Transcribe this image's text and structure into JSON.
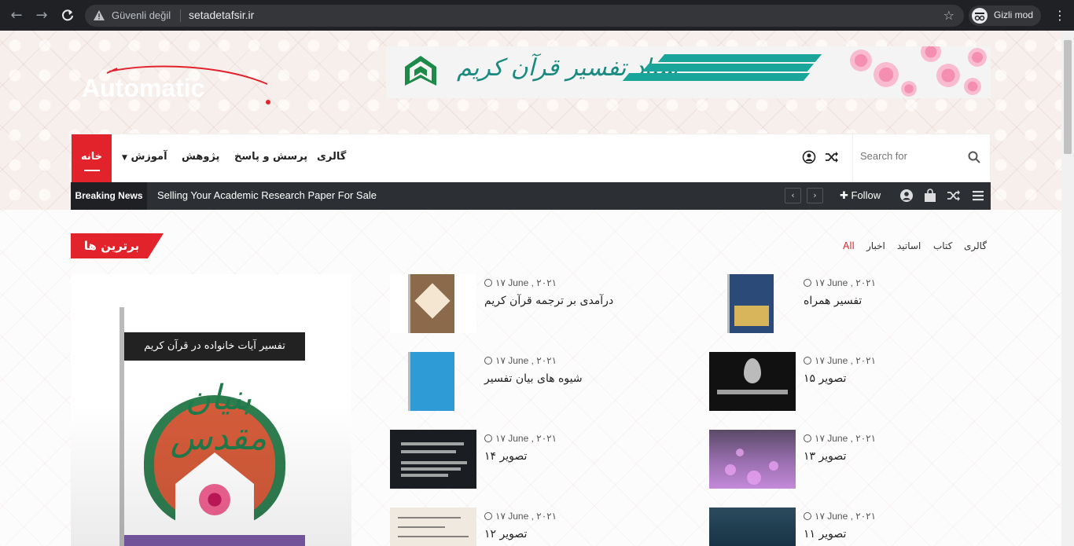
{
  "browser": {
    "back_icon": "arrow-left-icon",
    "forward_icon": "arrow-right-icon",
    "reload_icon": "reload-icon",
    "security_label": "Güvenli değil",
    "url": "setadetafsir.ir",
    "incognito_label": "Gizli mod"
  },
  "header": {
    "logo_text": "Automatic",
    "banner_title": "ستاد تفسیر قرآن کریم"
  },
  "nav": {
    "home": "خانه",
    "items": [
      "آموزش",
      "پژوهش",
      "پرسش و پاسخ",
      "گالری"
    ],
    "search_placeholder": "Search for"
  },
  "breaking": {
    "label": "Breaking News",
    "headline": "Selling Your Academic Research Paper For Sale",
    "follow": "Follow"
  },
  "section": {
    "title": "برترین ها",
    "filters": [
      "All",
      "اخبار",
      "اساتید",
      "کتاب",
      "گالری"
    ],
    "active_filter": "All"
  },
  "featured": {
    "book_header": "تفسیر آیات خانواده در قرآن کریم",
    "book_title": "بنیان مقدس"
  },
  "posts": [
    {
      "date": "۱۷ June , ۲۰۲۱",
      "title": "درآمدی بر ترجمه قرآن کریم"
    },
    {
      "date": "۱۷ June , ۲۰۲۱",
      "title": "تفسیر همراه"
    },
    {
      "date": "۱۷ June , ۲۰۲۱",
      "title": "شیوه های بیان تفسیر"
    },
    {
      "date": "۱۷ June , ۲۰۲۱",
      "title": "تصویر ۱۵"
    },
    {
      "date": "۱۷ June , ۲۰۲۱",
      "title": "تصویر ۱۴"
    },
    {
      "date": "۱۷ June , ۲۰۲۱",
      "title": "تصویر ۱۳"
    },
    {
      "date": "۱۷ June , ۲۰۲۱",
      "title": "تصویر ۱۲"
    },
    {
      "date": "۱۷ June , ۲۰۲۱",
      "title": "تصویر ۱۱"
    }
  ]
}
